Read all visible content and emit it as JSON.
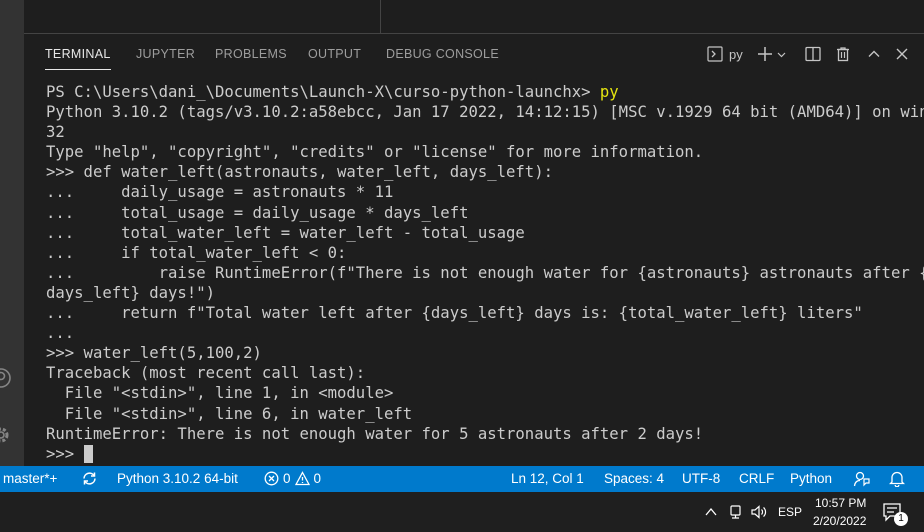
{
  "panel": {
    "tabs": [
      {
        "label": "TERMINAL",
        "active": true
      },
      {
        "label": "JUPYTER",
        "active": false
      },
      {
        "label": "PROBLEMS",
        "active": false
      },
      {
        "label": "OUTPUT",
        "active": false
      },
      {
        "label": "DEBUG CONSOLE",
        "active": false
      }
    ],
    "terminal_name": "py"
  },
  "terminal": {
    "lines": [
      {
        "prefix": "PS C:\\Users\\dani_\\Documents\\Launch-X\\curso-python-launchx> ",
        "cmd": "py"
      },
      {
        "text": "Python 3.10.2 (tags/v3.10.2:a58ebcc, Jan 17 2022, 14:12:15) [MSC v.1929 64 bit (AMD64)] on win"
      },
      {
        "text": "32"
      },
      {
        "text": "Type \"help\", \"copyright\", \"credits\" or \"license\" for more information."
      },
      {
        "text": ">>> def water_left(astronauts, water_left, days_left):"
      },
      {
        "text": "...     daily_usage = astronauts * 11"
      },
      {
        "text": "...     total_usage = daily_usage * days_left"
      },
      {
        "text": "...     total_water_left = water_left - total_usage"
      },
      {
        "text": "...     if total_water_left < 0:"
      },
      {
        "text": "...         raise RuntimeError(f\"There is not enough water for {astronauts} astronauts after {"
      },
      {
        "text": "days_left} days!\")"
      },
      {
        "text": "...     return f\"Total water left after {days_left} days is: {total_water_left} liters\""
      },
      {
        "text": "..."
      },
      {
        "text": ">>> water_left(5,100,2)"
      },
      {
        "text": "Traceback (most recent call last):"
      },
      {
        "text": "  File \"<stdin>\", line 1, in <module>"
      },
      {
        "text": "  File \"<stdin>\", line 6, in water_left"
      },
      {
        "text": "RuntimeError: There is not enough water for 5 astronauts after 2 days!"
      }
    ],
    "prompt": ">>> "
  },
  "statusbar": {
    "branch": "master*+",
    "interpreter": "Python 3.10.2 64-bit",
    "errors": "0",
    "warnings": "0",
    "position": "Ln 12, Col 1",
    "spaces": "Spaces: 4",
    "encoding": "UTF-8",
    "eol": "CRLF",
    "language": "Python",
    "accent_color": "#007acc"
  },
  "taskbar": {
    "language": "ESP",
    "time": "10:57 PM",
    "date": "2/20/2022",
    "notification_count": "1"
  }
}
